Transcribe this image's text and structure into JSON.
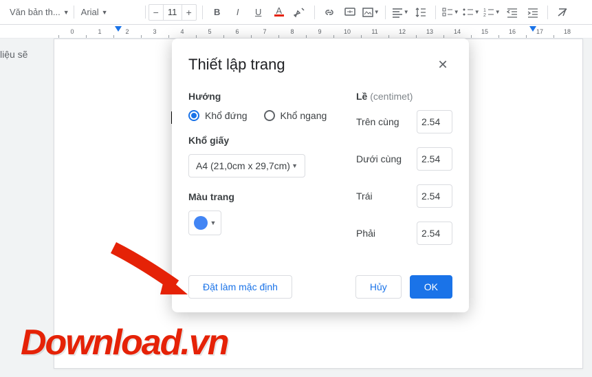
{
  "toolbar": {
    "style_select": "Văn bản th...",
    "font_select": "Arial",
    "font_size": "11"
  },
  "ruler": {
    "ticks": [
      "0",
      "1",
      "2",
      "3",
      "4",
      "5",
      "6",
      "7",
      "8",
      "9",
      "10",
      "11",
      "12",
      "13",
      "14",
      "15",
      "16",
      "17",
      "18"
    ]
  },
  "sidebar": {
    "text": "liệu sẽ"
  },
  "dialog": {
    "title": "Thiết lập trang",
    "orientation": {
      "label": "Hướng",
      "portrait": "Khổ đứng",
      "landscape": "Khổ ngang"
    },
    "paper": {
      "label": "Khổ giấy",
      "value": "A4 (21,0cm x 29,7cm)"
    },
    "color": {
      "label": "Màu trang"
    },
    "margins": {
      "label": "Lề",
      "unit": "(centimet)",
      "top_label": "Trên cùng",
      "top_value": "2.54",
      "bottom_label": "Dưới cùng",
      "bottom_value": "2.54",
      "left_label": "Trái",
      "left_value": "2.54",
      "right_label": "Phải",
      "right_value": "2.54"
    },
    "buttons": {
      "set_default": "Đặt làm mặc định",
      "cancel": "Hủy",
      "ok": "OK"
    }
  },
  "watermark": "Download.vn"
}
